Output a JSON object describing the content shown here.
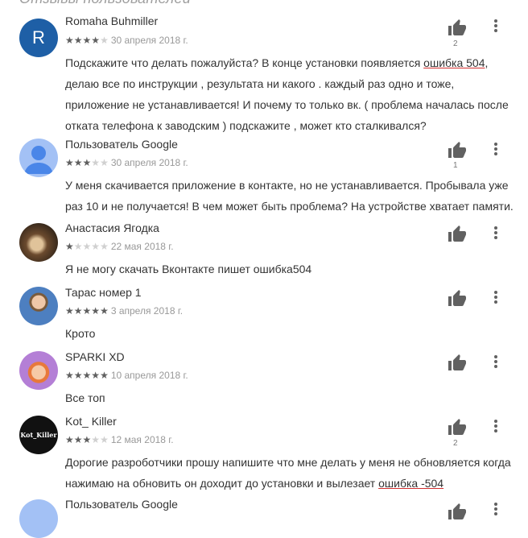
{
  "section_title": "Отзывы пользователей",
  "colors": {
    "star_on": "#5f5f5f",
    "star_off": "#d0d0d0",
    "underline": "#d32f2f"
  },
  "reviews": [
    {
      "name": "Romaha Buhmiller",
      "avatar_letter": "R",
      "avatar_color": "#1e5fa6",
      "stars": 4,
      "date": "30 апреля 2018 г.",
      "text_before": "Подскажите что делать пожалуйста? В конце установки появляется ",
      "text_highlight": "ошибка 504",
      "text_after": ",\nделаю все по инструкции , результата ни какого . каждый раз одно и тоже,\nприложение не устанавливается! И почему то только вк. ( проблема началась после\nотката телефона к заводским ) подскажите , может кто сталкивался?",
      "likes": "2"
    },
    {
      "name": "Пользователь Google",
      "avatar_letter": "",
      "avatar_color": "#7baaf7",
      "stars": 3,
      "date": "30 апреля 2018 г.",
      "text": "У меня скачивается приложение в контакте, но не устанавливается. Пробывала уже\nраз 10 и не получается! В чем может быть проблема? На устройстве хватает памяти.",
      "likes": "1"
    },
    {
      "name": "Анастасия Ягодка",
      "avatar_color": "#8b5e3c",
      "stars": 1,
      "date": "22 мая 2018 г.",
      "text": "Я не могу скачать Вконтакте пишет ошибка504",
      "likes": ""
    },
    {
      "name": "Тарас номер 1",
      "avatar_color": "#5a7db0",
      "stars": 5,
      "date": "3 апреля 2018 г.",
      "text": "Крото",
      "likes": ""
    },
    {
      "name": "SPARKI XD",
      "avatar_color": "#b47fd6",
      "stars": 5,
      "date": "10 апреля 2018 г.",
      "text": "Все топ",
      "likes": ""
    },
    {
      "name": "Kot_ Killer",
      "avatar_text": "Kot_Killer",
      "avatar_color": "#111111",
      "stars": 3,
      "date": "12 мая 2018 г.",
      "text_before": "Дорогие разроботчики прошу напишите что мне делать у меня не обновляется когда\nнажимаю на обновить он доходит до установки и вылезает ",
      "text_highlight": "ошибка -504",
      "text_after": "",
      "likes": "2"
    },
    {
      "name": "Пользователь Google",
      "avatar_color": "#7baaf7",
      "likes": ""
    }
  ]
}
